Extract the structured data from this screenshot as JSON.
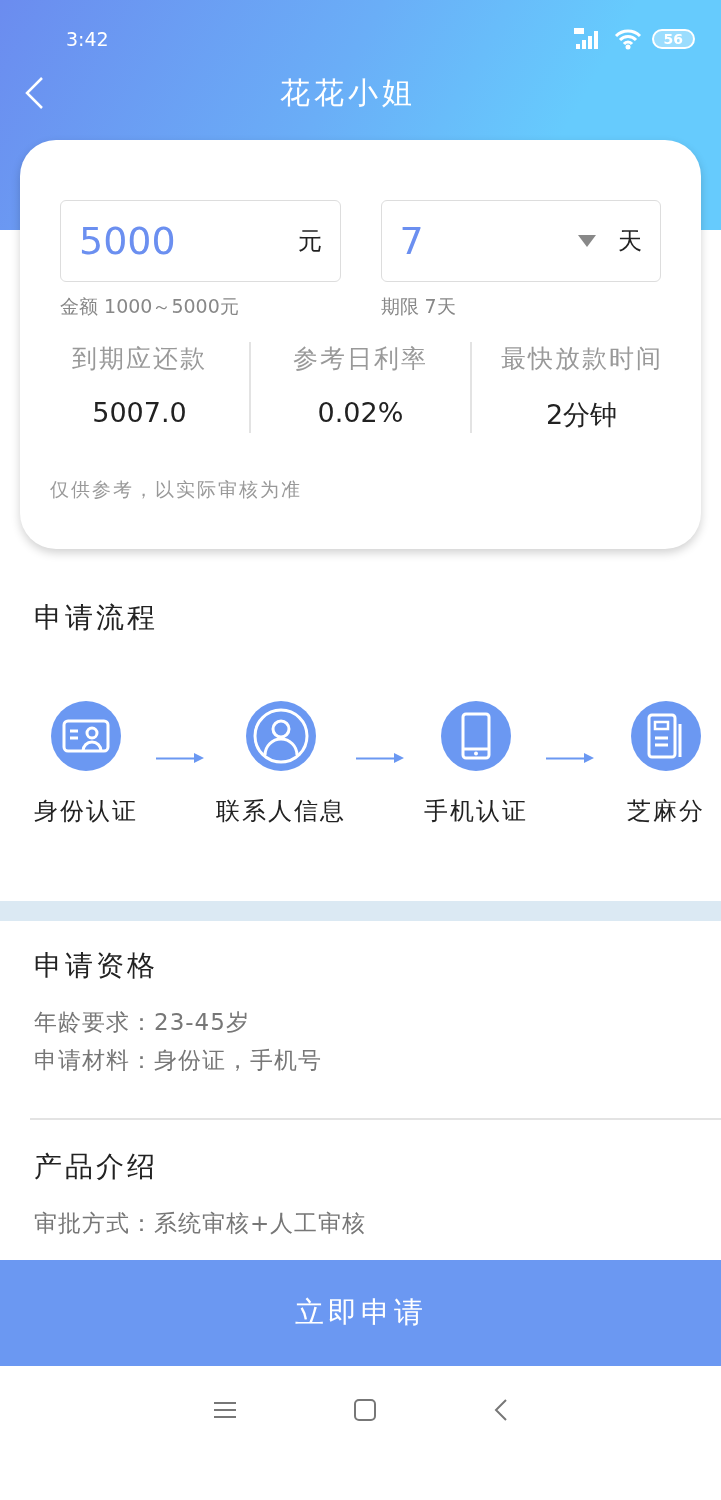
{
  "status_bar": {
    "time": "3:42",
    "battery": "56"
  },
  "header": {
    "title": "花花小姐"
  },
  "loan": {
    "amount": {
      "value": "5000",
      "unit": "元",
      "hint": "金额 1000～5000元"
    },
    "term": {
      "value": "7",
      "unit": "天",
      "hint": "期限 7天"
    },
    "stats": [
      {
        "label": "到期应还款",
        "value": "5007.0"
      },
      {
        "label": "参考日利率",
        "value": "0.02%"
      },
      {
        "label": "最快放款时间",
        "value": "2分钟"
      }
    ],
    "note": "仅供参考，以实际审核为准"
  },
  "process": {
    "title": "申请流程",
    "steps": [
      {
        "label": "身份认证",
        "kind": "idcard"
      },
      {
        "label": "联系人信息",
        "kind": "contact"
      },
      {
        "label": "手机认证",
        "kind": "phone"
      },
      {
        "label": "芝麻分",
        "kind": "document"
      }
    ]
  },
  "qualification": {
    "title": "申请资格",
    "lines": [
      "年龄要求：23-45岁",
      "申请材料：身份证，手机号"
    ]
  },
  "product": {
    "title": "产品介绍",
    "lines": [
      "审批方式：系统审核+人工审核"
    ]
  },
  "apply_button": "立即申请"
}
